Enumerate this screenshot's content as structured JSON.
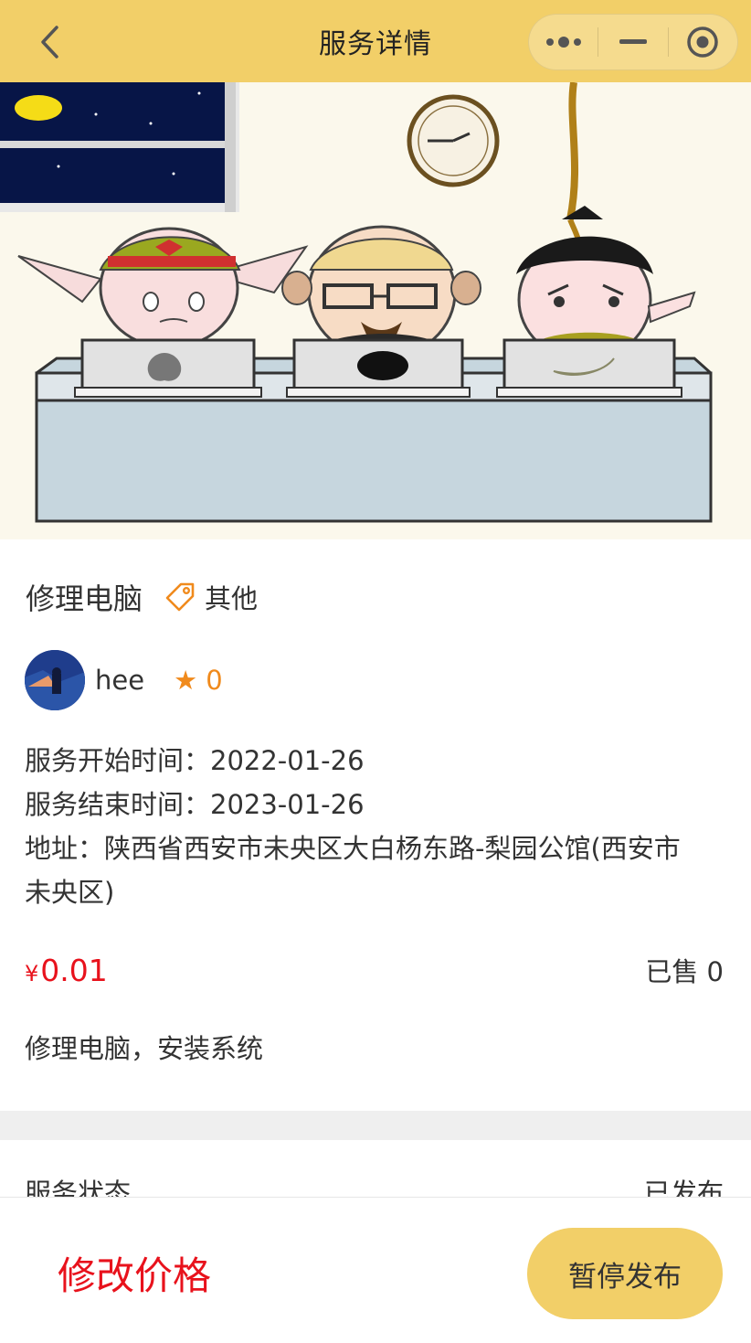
{
  "navbar": {
    "title": "服务详情"
  },
  "service": {
    "name": "修理电脑",
    "category": "其他",
    "provider_name": "hee",
    "rating_star": "★",
    "rating_value": "0",
    "start_time": "服务开始时间：2022-01-26",
    "end_time": "服务结束时间：2023-01-26",
    "address_line1": "地址：陕西省西安市未央区大白杨东路-梨园公馆(西安市",
    "address_line2": "未央区)",
    "currency": "¥",
    "price": "0.01",
    "sold": "已售 0",
    "description": "修理电脑，安装系统"
  },
  "status": {
    "label": "服务状态",
    "value": "已发布"
  },
  "actions": {
    "modify_price": "修改价格",
    "pause_publish": "暂停发布"
  },
  "colors": {
    "navbar_bg": "#f2cf68",
    "price": "#e8121c",
    "rating": "#f08a1c",
    "primary_button": "#f2cf68"
  },
  "icons": {
    "back": "chevron-left-icon",
    "more": "more-dots-icon",
    "minimize": "minus-icon",
    "close": "target-circle-icon",
    "tag": "tag-icon"
  }
}
